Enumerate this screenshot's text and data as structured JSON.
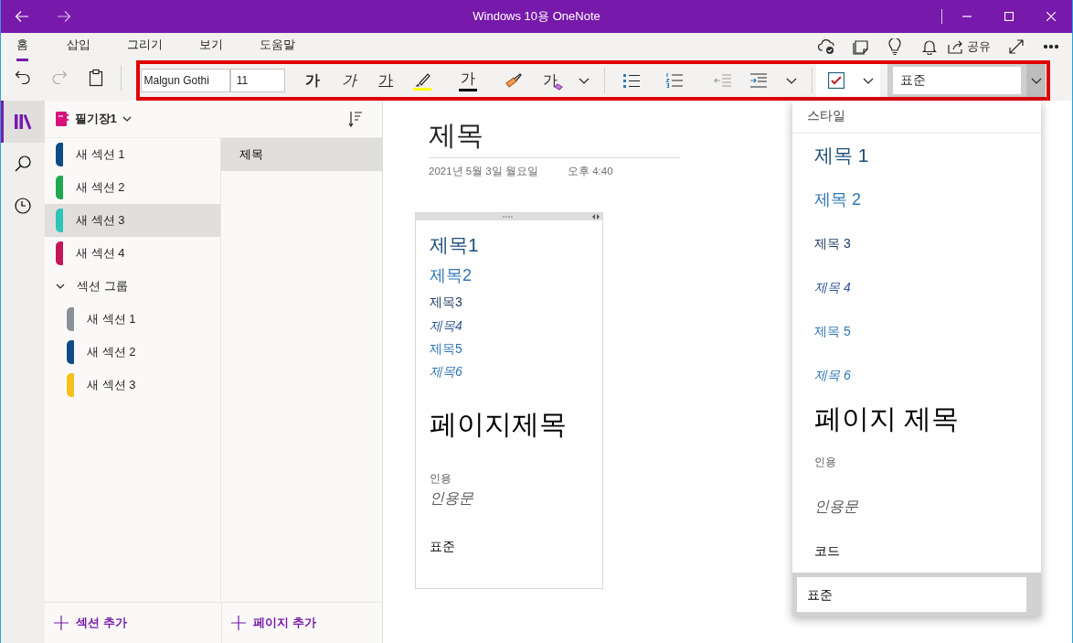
{
  "window": {
    "title": "Windows 10용 OneNote"
  },
  "ribbon_tabs": [
    {
      "label": "홈",
      "selected": true
    },
    {
      "label": "삽입",
      "selected": false
    },
    {
      "label": "그리기",
      "selected": false
    },
    {
      "label": "보기",
      "selected": false
    },
    {
      "label": "도움말",
      "selected": false
    }
  ],
  "share": {
    "label": "공유"
  },
  "toolbar": {
    "font": "Malgun Gothi",
    "size": "11",
    "style": "표준",
    "format_buttons": [
      {
        "kind": "bold",
        "label": "가"
      },
      {
        "kind": "italic",
        "label": "가"
      },
      {
        "kind": "underline",
        "label": "가"
      },
      {
        "kind": "highlight"
      },
      {
        "kind": "font_color",
        "label": "가"
      },
      {
        "kind": "painter"
      },
      {
        "kind": "clear",
        "label": "가"
      }
    ]
  },
  "notebook": {
    "name": "필기장1"
  },
  "sections": [
    {
      "kind": "section",
      "label": "새 섹션 1",
      "color": "#0f4b85",
      "selected": false
    },
    {
      "kind": "section",
      "label": "새 섹션 2",
      "color": "#1fa84f",
      "selected": false
    },
    {
      "kind": "section",
      "label": "새 섹션 3",
      "color": "#2ec4b6",
      "selected": true
    },
    {
      "kind": "section",
      "label": "새 섹션 4",
      "color": "#c2185b",
      "selected": false
    },
    {
      "kind": "group",
      "label": "섹션 그룹",
      "expanded": true,
      "children": [
        {
          "kind": "section",
          "label": "새 섹션 1",
          "color": "#8a9196",
          "selected": false
        },
        {
          "kind": "section",
          "label": "새 섹션 2",
          "color": "#0f4b85",
          "selected": false
        },
        {
          "kind": "section",
          "label": "새 섹션 3",
          "color": "#f5c11a",
          "selected": false
        }
      ]
    }
  ],
  "pages": [
    {
      "title": "제목",
      "selected": true
    }
  ],
  "add_section": "섹션 추가",
  "add_page": "페이지 추가",
  "page": {
    "title": "제목",
    "date": "2021년 5월 3일 월요일",
    "time": "오후 4:40",
    "lines": [
      {
        "kind": "h1",
        "text": "제목1"
      },
      {
        "kind": "h2",
        "text": "제목2"
      },
      {
        "kind": "h3",
        "text": "제목3"
      },
      {
        "kind": "h4",
        "text": "제목4"
      },
      {
        "kind": "h5",
        "text": "제목5"
      },
      {
        "kind": "h6",
        "text": "제목6"
      },
      {
        "kind": "title",
        "text": "페이지제목"
      },
      {
        "kind": "quote_label",
        "text": "인용"
      },
      {
        "kind": "quote",
        "text": "인용문"
      },
      {
        "kind": "normal",
        "text": "표준"
      }
    ]
  },
  "style_menu": {
    "header": "스타일",
    "items": [
      {
        "kind": "h1",
        "label": "제목 1",
        "selected": false
      },
      {
        "kind": "h2",
        "label": "제목 2",
        "selected": false
      },
      {
        "kind": "h3",
        "label": "제목 3",
        "selected": false
      },
      {
        "kind": "h4",
        "label": "제목 4",
        "selected": false
      },
      {
        "kind": "h5",
        "label": "제목 5",
        "selected": false
      },
      {
        "kind": "h6",
        "label": "제목 6",
        "selected": false
      },
      {
        "kind": "title",
        "label": "페이지 제목",
        "selected": false
      },
      {
        "kind": "quote_label",
        "label": "인용",
        "selected": false
      },
      {
        "kind": "quote",
        "label": "인용문",
        "selected": false
      },
      {
        "kind": "code",
        "label": "코드",
        "selected": false
      },
      {
        "kind": "normal",
        "label": "표준",
        "selected": true
      }
    ]
  }
}
